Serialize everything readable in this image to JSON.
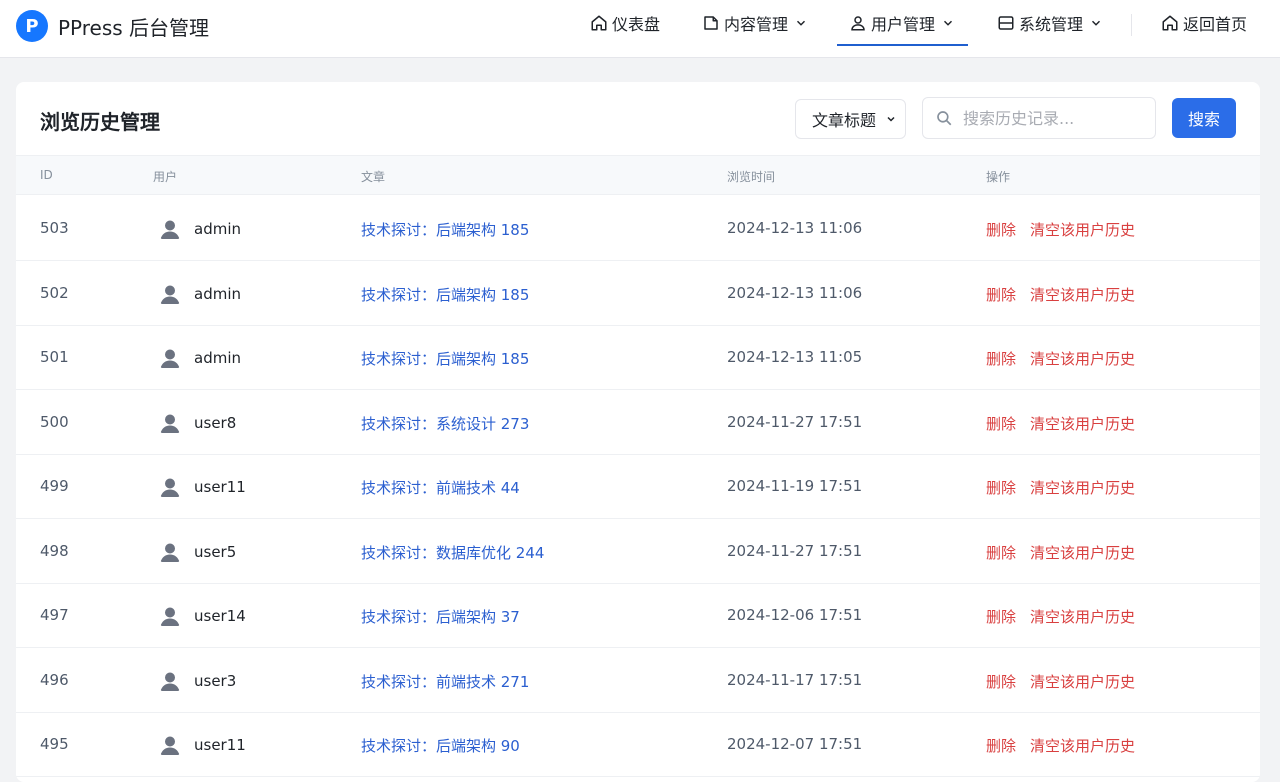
{
  "brand": {
    "logo_letter": "P",
    "name": "PPress 后台管理",
    "color": "#1677ff"
  },
  "nav": {
    "dashboard": "仪表盘",
    "content": "内容管理",
    "users": "用户管理",
    "system": "系统管理",
    "home": "返回首页",
    "active": "users"
  },
  "page": {
    "title": "浏览历史管理",
    "filter_select": "文章标题",
    "search_placeholder": "搜索历史记录...",
    "search_button": "搜索"
  },
  "table": {
    "headers": {
      "id": "ID",
      "user": "用户",
      "article": "文章",
      "time": "浏览时间",
      "actions": "操作"
    },
    "delete_label": "删除",
    "clear_label": "清空该用户历史",
    "rows": [
      {
        "id": "503",
        "user": "admin",
        "article": "技术探讨：后端架构 185",
        "time": "2024-12-13 11:06"
      },
      {
        "id": "502",
        "user": "admin",
        "article": "技术探讨：后端架构 185",
        "time": "2024-12-13 11:06"
      },
      {
        "id": "501",
        "user": "admin",
        "article": "技术探讨：后端架构 185",
        "time": "2024-12-13 11:05"
      },
      {
        "id": "500",
        "user": "user8",
        "article": "技术探讨：系统设计 273",
        "time": "2024-11-27 17:51"
      },
      {
        "id": "499",
        "user": "user11",
        "article": "技术探讨：前端技术 44",
        "time": "2024-11-19 17:51"
      },
      {
        "id": "498",
        "user": "user5",
        "article": "技术探讨：数据库优化 244",
        "time": "2024-11-27 17:51"
      },
      {
        "id": "497",
        "user": "user14",
        "article": "技术探讨：后端架构 37",
        "time": "2024-12-06 17:51"
      },
      {
        "id": "496",
        "user": "user3",
        "article": "技术探讨：前端技术 271",
        "time": "2024-11-17 17:51"
      },
      {
        "id": "495",
        "user": "user11",
        "article": "技术探讨：后端架构 90",
        "time": "2024-12-07 17:51"
      }
    ]
  },
  "colors": {
    "primary": "#2b6de8",
    "link": "#2b5fd0",
    "danger": "#d94040"
  }
}
